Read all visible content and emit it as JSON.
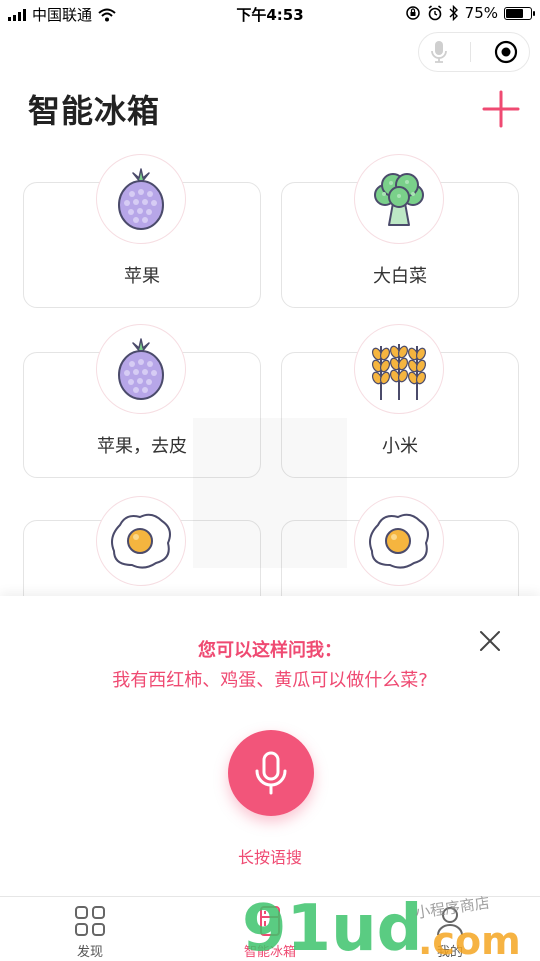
{
  "status": {
    "carrier": "中国联通",
    "time": "下午4:53",
    "battery_percent": "75%",
    "battery_level": 0.75
  },
  "header": {
    "title": "智能冰箱"
  },
  "items": [
    {
      "label": "苹果",
      "icon": "raspberry-icon"
    },
    {
      "label": "大白菜",
      "icon": "broccoli-icon"
    },
    {
      "label": "苹果，去皮",
      "icon": "raspberry-icon"
    },
    {
      "label": "小米",
      "icon": "wheat-icon"
    },
    {
      "label": "",
      "icon": "fried-egg-icon"
    },
    {
      "label": "",
      "icon": "fried-egg-icon"
    }
  ],
  "voice_panel": {
    "tip_title": "您可以这样问我：",
    "tip_example": "我有西红柿、鸡蛋、黄瓜可以做什么菜?",
    "mic_label": "长按语搜"
  },
  "tabbar": {
    "tabs": [
      {
        "label": "发现",
        "icon": "grid-icon"
      },
      {
        "label": "智能冰箱",
        "icon": "fridge-icon"
      },
      {
        "label": "我的",
        "icon": "user-icon"
      }
    ]
  },
  "watermark": {
    "logo": "91ud",
    "domain": ".com",
    "tagline": "小程序商店"
  },
  "colors": {
    "accent": "#ef4a72",
    "card_border": "#e4e4e4",
    "berry": "#b7a6e8",
    "leaf": "#7ad08a",
    "egg_yolk": "#f5b53f"
  }
}
